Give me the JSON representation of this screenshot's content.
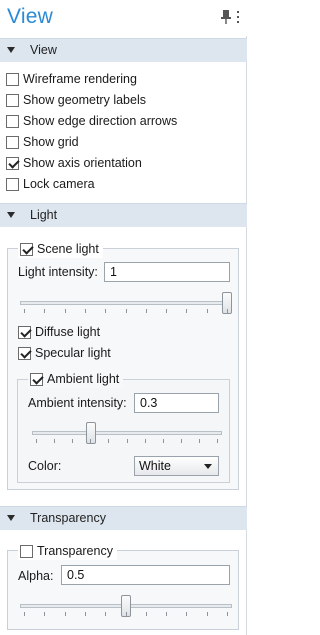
{
  "panel": {
    "title": "View"
  },
  "view_section": {
    "header": "View",
    "checkboxes": [
      {
        "label": "Wireframe rendering",
        "checked": false
      },
      {
        "label": "Show geometry labels",
        "checked": false
      },
      {
        "label": "Show edge direction arrows",
        "checked": false
      },
      {
        "label": "Show grid",
        "checked": false
      },
      {
        "label": "Show axis orientation",
        "checked": true
      },
      {
        "label": "Lock camera",
        "checked": false
      }
    ]
  },
  "light_section": {
    "header": "Light",
    "scene_light": {
      "label": "Scene light",
      "checked": true
    },
    "intensity_label": "Light intensity:",
    "intensity_value": "1",
    "intensity_slider_fraction": 1.0,
    "diffuse": {
      "label": "Diffuse light",
      "checked": true
    },
    "specular": {
      "label": "Specular light",
      "checked": true
    },
    "ambient": {
      "label": "Ambient light",
      "checked": true
    },
    "ambient_intensity_label": "Ambient intensity:",
    "ambient_intensity_value": "0.3",
    "ambient_slider_fraction": 0.3,
    "color_label": "Color:",
    "color_value": "White"
  },
  "transparency_section": {
    "header": "Transparency",
    "transparency": {
      "label": "Transparency",
      "checked": false
    },
    "alpha_label": "Alpha:",
    "alpha_value": "0.5",
    "alpha_slider_fraction": 0.5
  },
  "colors": {
    "accent": "#2b8ad6",
    "section_header_bg": "#dde6ef"
  }
}
